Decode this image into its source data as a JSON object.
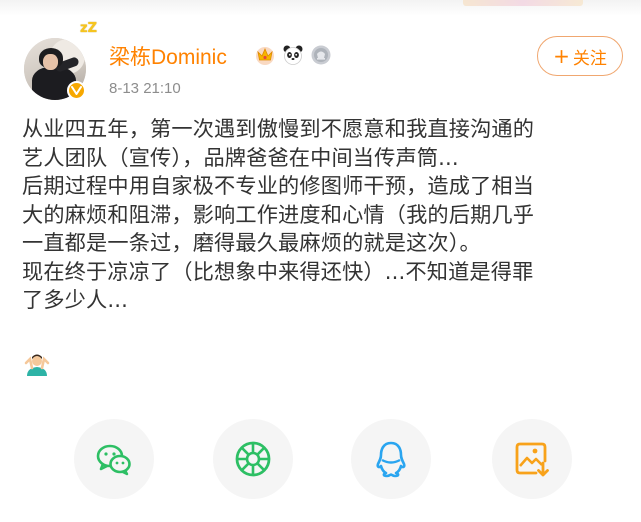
{
  "user": {
    "name": "梁栋Dominic",
    "timestamp": "8-13 21:10",
    "status_glyph": "zZ",
    "badges": [
      "crown-badge-icon",
      "panda-badge-icon",
      "medal-badge-icon"
    ]
  },
  "follow_button": {
    "plus": "+",
    "label": "关注"
  },
  "post": {
    "lines": [
      "从业四五年，第一次遇到傲慢到不愿意和我直接沟通的",
      "艺人团队（宣传），品牌爸爸在中间当传声筒...",
      "后期过程中用自家极不专业的修图师干预，造成了相当",
      "大的麻烦和阻滞，影响工作进度和心情（我的后期几乎",
      "一直都是一条过，磨得最久最麻烦的就是这次）。",
      "现在终于凉凉了（比想象中来得还快）...不知道是得罪",
      "了多少人..."
    ],
    "emoji": "person-shrugging-icon"
  },
  "share_targets": [
    "wechat-icon",
    "wechat-moments-icon",
    "qq-icon",
    "save-image-icon"
  ],
  "colors": {
    "accent": "#ff8200",
    "follow_border": "#f0a770",
    "text": "#333333",
    "muted": "#8d8d8d",
    "share_green": "#2dbf64",
    "share_blue": "#2aa5f0",
    "share_orange": "#f8a21a"
  }
}
